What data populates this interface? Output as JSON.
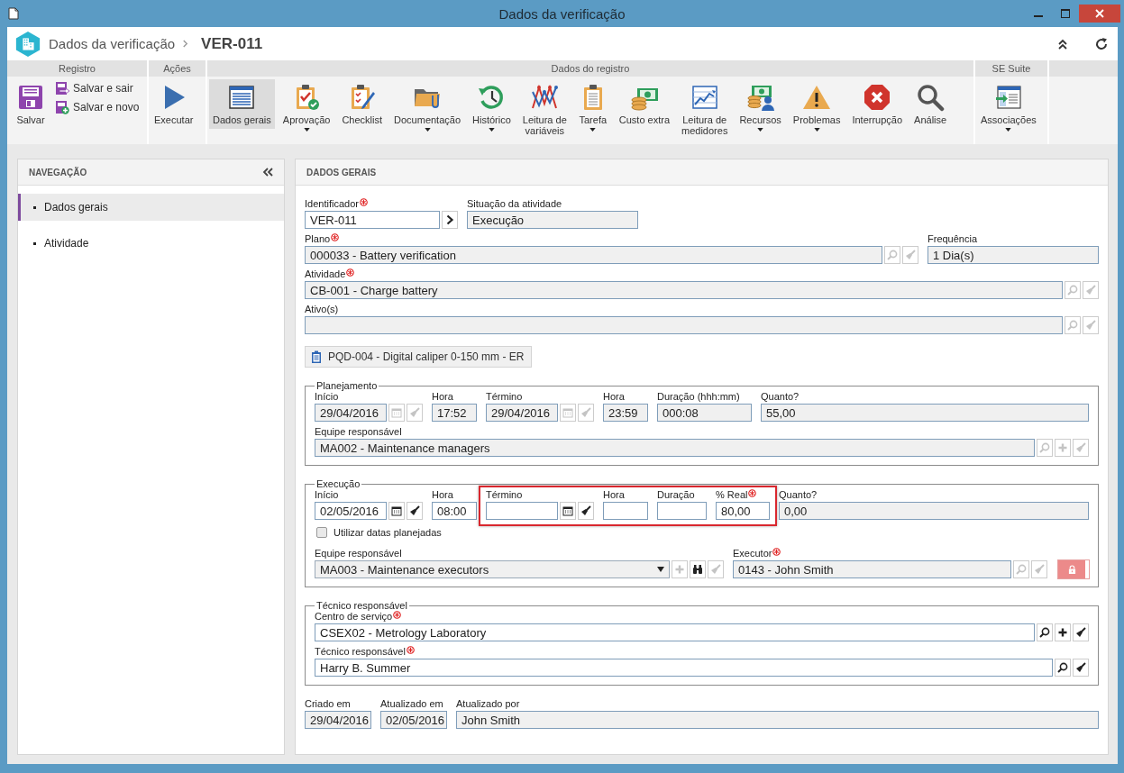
{
  "window": {
    "title": "Dados da verificação"
  },
  "header": {
    "breadcrumb": "Dados da verificação",
    "record": "VER-011"
  },
  "toolbar": {
    "groups": [
      {
        "label": "Registro",
        "items": [
          {
            "label": "Salvar",
            "kind": "large",
            "selected": false,
            "dropdown": false
          },
          {
            "label": "Salvar e sair",
            "kind": "small",
            "selected": false,
            "dropdown": false
          },
          {
            "label": "Salvar e novo",
            "kind": "small",
            "selected": false,
            "dropdown": false
          }
        ]
      },
      {
        "label": "Ações",
        "items": [
          {
            "label": "Executar",
            "kind": "large",
            "selected": false,
            "dropdown": false
          }
        ]
      },
      {
        "label": "Dados do registro",
        "items": [
          {
            "label": "Dados gerais",
            "kind": "large",
            "selected": true,
            "dropdown": false
          },
          {
            "label": "Aprovação",
            "kind": "large",
            "selected": false,
            "dropdown": true
          },
          {
            "label": "Checklist",
            "kind": "large",
            "selected": false,
            "dropdown": false
          },
          {
            "label": "Documentação",
            "kind": "large",
            "selected": false,
            "dropdown": true
          },
          {
            "label": "Histórico",
            "kind": "large",
            "selected": false,
            "dropdown": true
          },
          {
            "label": "Leitura de variáveis",
            "kind": "large",
            "selected": false,
            "dropdown": false
          },
          {
            "label": "Tarefa",
            "kind": "large",
            "selected": false,
            "dropdown": true
          },
          {
            "label": "Custo extra",
            "kind": "large",
            "selected": false,
            "dropdown": false
          },
          {
            "label": "Leitura de medidores",
            "kind": "large",
            "selected": false,
            "dropdown": false
          },
          {
            "label": "Recursos",
            "kind": "large",
            "selected": false,
            "dropdown": true
          },
          {
            "label": "Problemas",
            "kind": "large",
            "selected": false,
            "dropdown": true
          },
          {
            "label": "Interrupção",
            "kind": "large",
            "selected": false,
            "dropdown": false
          },
          {
            "label": "Análise",
            "kind": "large",
            "selected": false,
            "dropdown": false
          }
        ]
      },
      {
        "label": "SE Suite",
        "items": [
          {
            "label": "Associações",
            "kind": "large",
            "selected": false,
            "dropdown": true
          }
        ]
      }
    ]
  },
  "sidebar": {
    "title": "NAVEGAÇÃO",
    "items": [
      {
        "label": "Dados gerais",
        "selected": true
      },
      {
        "label": "Atividade",
        "selected": false
      }
    ]
  },
  "form": {
    "title": "DADOS GERAIS",
    "blocks": [
      {
        "kind": "row",
        "fields": [
          {
            "kind": "text",
            "label": "Identificador",
            "required": true,
            "value": "VER-011",
            "readonly": false,
            "actions": [
              {
                "kind": "go",
                "disabled": false
              }
            ]
          },
          {
            "kind": "text",
            "label": "Situação da atividade",
            "required": false,
            "value": "Execução",
            "readonly": true
          }
        ]
      },
      {
        "kind": "row",
        "fields": [
          {
            "kind": "text",
            "label": "Plano",
            "required": true,
            "value": "000033 - Battery verification",
            "readonly": true,
            "actions": [
              {
                "kind": "search",
                "disabled": true
              },
              {
                "kind": "clear",
                "disabled": true
              }
            ]
          },
          {
            "kind": "text",
            "label": "Frequência",
            "required": false,
            "value": "1 Dia(s)",
            "readonly": true
          }
        ]
      },
      {
        "kind": "row",
        "fields": [
          {
            "kind": "text",
            "label": "Atividade",
            "required": true,
            "value": "CB-001 - Charge battery",
            "readonly": true,
            "actions": [
              {
                "kind": "search",
                "disabled": true
              },
              {
                "kind": "clear",
                "disabled": true
              }
            ]
          }
        ]
      },
      {
        "kind": "row",
        "fields": [
          {
            "kind": "text",
            "label": "Ativo(s)",
            "required": false,
            "readonly": true,
            "actions": [
              {
                "kind": "search",
                "disabled": true
              },
              {
                "kind": "clear",
                "disabled": true
              }
            ]
          }
        ]
      },
      {
        "kind": "chip",
        "label": "PQD-004 - Digital caliper 0-150 mm - ER"
      },
      {
        "kind": "fieldset",
        "legend": "Planejamento",
        "blocks": [
          {
            "kind": "row",
            "fields": [
              {
                "kind": "text",
                "label": "Início",
                "required": false,
                "value": "29/04/2016",
                "readonly": true,
                "actions": [
                  {
                    "kind": "calendar",
                    "disabled": true
                  },
                  {
                    "kind": "clear",
                    "disabled": true
                  }
                ]
              },
              {
                "kind": "text",
                "label": "Hora",
                "required": false,
                "value": "17:52",
                "readonly": true
              },
              {
                "kind": "text",
                "label": "Término",
                "required": false,
                "value": "29/04/2016",
                "readonly": true,
                "actions": [
                  {
                    "kind": "calendar",
                    "disabled": true
                  },
                  {
                    "kind": "clear",
                    "disabled": true
                  }
                ]
              },
              {
                "kind": "text",
                "label": "Hora",
                "required": false,
                "value": "23:59",
                "readonly": true
              },
              {
                "kind": "text",
                "label": "Duração (hhh:mm)",
                "required": false,
                "value": "000:08",
                "readonly": true
              },
              {
                "kind": "text",
                "label": "Quanto?",
                "required": false,
                "value": "55,00",
                "readonly": true
              }
            ]
          },
          {
            "kind": "row",
            "fields": [
              {
                "kind": "text",
                "label": "Equipe responsável",
                "required": false,
                "value": "MA002 - Maintenance managers",
                "readonly": true,
                "actions": [
                  {
                    "kind": "search",
                    "disabled": true
                  },
                  {
                    "kind": "add",
                    "disabled": true
                  },
                  {
                    "kind": "clear",
                    "disabled": true
                  }
                ]
              }
            ]
          }
        ]
      },
      {
        "kind": "fieldset",
        "legend": "Execução",
        "blocks": [
          {
            "kind": "row",
            "fields": [
              {
                "kind": "text",
                "label": "Início",
                "required": false,
                "value": "02/05/2016",
                "readonly": false,
                "highlighted": false,
                "actions": [
                  {
                    "kind": "calendar",
                    "disabled": false
                  },
                  {
                    "kind": "clear",
                    "disabled": false
                  }
                ]
              },
              {
                "kind": "text",
                "label": "Hora",
                "required": false,
                "value": "08:00",
                "readonly": false,
                "highlighted": false
              },
              {
                "kind": "text",
                "label": "Término",
                "required": false,
                "readonly": false,
                "highlighted": true,
                "actions": [
                  {
                    "kind": "calendar",
                    "disabled": false
                  },
                  {
                    "kind": "clear",
                    "disabled": false
                  }
                ]
              },
              {
                "kind": "text",
                "label": "Hora",
                "required": false,
                "readonly": false,
                "highlighted": true
              },
              {
                "kind": "text",
                "label": "Duração",
                "required": false,
                "readonly": false,
                "highlighted": true
              },
              {
                "kind": "text",
                "label": "% Real",
                "required": true,
                "value": "80,00",
                "readonly": false,
                "highlighted": true
              },
              {
                "kind": "text",
                "label": "Quanto?",
                "required": false,
                "value": "0,00",
                "readonly": true,
                "highlighted": false
              }
            ]
          },
          {
            "kind": "checkbox",
            "label": "Utilizar datas planejadas",
            "checked": false
          },
          {
            "kind": "row",
            "fields": [
              {
                "kind": "select",
                "label": "Equipe responsável",
                "required": false,
                "value": "MA003 - Maintenance executors",
                "readonly": true,
                "actions": [
                  {
                    "kind": "add",
                    "disabled": true
                  },
                  {
                    "kind": "binoculars",
                    "disabled": false
                  },
                  {
                    "kind": "clear",
                    "disabled": true
                  }
                ]
              },
              {
                "kind": "text",
                "label": "Executor",
                "required": true,
                "value": "0143 - John Smith",
                "readonly": true,
                "actions": [
                  {
                    "kind": "search",
                    "disabled": true
                  },
                  {
                    "kind": "clear",
                    "disabled": true
                  }
                ]
              },
              {
                "kind": "lock"
              }
            ]
          }
        ]
      },
      {
        "kind": "fieldset",
        "legend": "Técnico responsável",
        "blocks": [
          {
            "kind": "row",
            "fields": [
              {
                "kind": "text",
                "label": "Centro de serviço",
                "required": true,
                "value": "CSEX02 - Metrology Laboratory",
                "readonly": false,
                "actions": [
                  {
                    "kind": "search",
                    "disabled": false
                  },
                  {
                    "kind": "add",
                    "disabled": false
                  },
                  {
                    "kind": "clear",
                    "disabled": false
                  }
                ]
              }
            ]
          },
          {
            "kind": "row",
            "fields": [
              {
                "kind": "text",
                "label": "Técnico responsável",
                "required": true,
                "value": "Harry B. Summer",
                "readonly": false,
                "actions": [
                  {
                    "kind": "search",
                    "disabled": false
                  },
                  {
                    "kind": "clear",
                    "disabled": false
                  }
                ]
              }
            ]
          }
        ]
      },
      {
        "kind": "row",
        "fields": [
          {
            "kind": "text",
            "label": "Criado em",
            "required": false,
            "value": "29/04/2016",
            "readonly": true
          },
          {
            "kind": "text",
            "label": "Atualizado em",
            "required": false,
            "value": "02/05/2016",
            "readonly": true
          },
          {
            "kind": "text",
            "label": "Atualizado por",
            "required": false,
            "value": "John Smith",
            "readonly": true
          }
        ]
      }
    ]
  }
}
